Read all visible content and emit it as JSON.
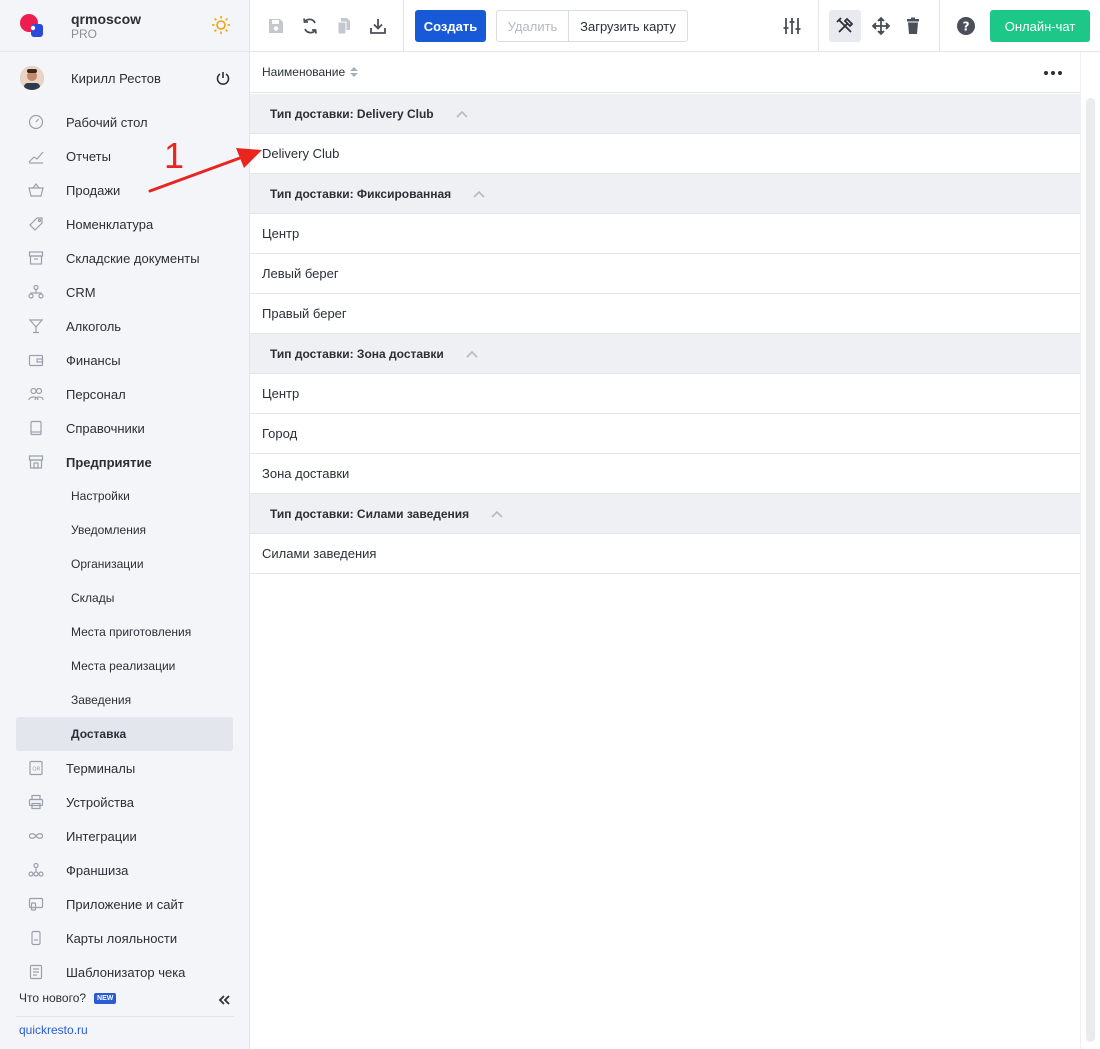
{
  "brand": {
    "name": "qrmoscow",
    "plan": "PRO"
  },
  "user": {
    "name": "Кирилл Рестов"
  },
  "menu": [
    {
      "label": "Рабочий стол",
      "icon": "dashboard-icon"
    },
    {
      "label": "Отчеты",
      "icon": "reports-icon"
    },
    {
      "label": "Продажи",
      "icon": "sales-icon"
    },
    {
      "label": "Номенклатура",
      "icon": "tag-icon"
    },
    {
      "label": "Складские документы",
      "icon": "archive-icon"
    },
    {
      "label": "CRM",
      "icon": "crm-icon"
    },
    {
      "label": "Алкоголь",
      "icon": "cocktail-icon"
    },
    {
      "label": "Финансы",
      "icon": "wallet-icon"
    },
    {
      "label": "Персонал",
      "icon": "staff-icon"
    },
    {
      "label": "Справочники",
      "icon": "book-icon"
    },
    {
      "label": "Предприятие",
      "icon": "store-icon"
    }
  ],
  "submenu": [
    "Настройки",
    "Уведомления",
    "Организации",
    "Склады",
    "Места приготовления",
    "Места реализации",
    "Заведения",
    "Доставка"
  ],
  "menu_bottom": [
    {
      "label": "Терминалы",
      "icon": "qr-terminal-icon"
    },
    {
      "label": "Устройства",
      "icon": "printer-icon"
    },
    {
      "label": "Интеграции",
      "icon": "infinity-icon"
    },
    {
      "label": "Франшиза",
      "icon": "franchise-icon"
    },
    {
      "label": "Приложение и сайт",
      "icon": "app-site-icon"
    },
    {
      "label": "Карты лояльности",
      "icon": "loyalty-card-icon"
    },
    {
      "label": "Шаблонизатор чека",
      "icon": "receipt-icon"
    }
  ],
  "footer": {
    "whats_new": "Что нового?",
    "badge": "NEW",
    "site": "quickresto.ru"
  },
  "toolbar": {
    "create": "Создать",
    "delete": "Удалить",
    "load_map": "Загрузить карту",
    "online_chat": "Онлайн-чат"
  },
  "table": {
    "column": "Наименование",
    "groups": [
      {
        "title": "Тип доставки: Delivery Club",
        "rows": [
          "Delivery Club"
        ]
      },
      {
        "title": "Тип доставки: Фиксированная",
        "rows": [
          "Центр",
          "Левый берег",
          "Правый берег"
        ]
      },
      {
        "title": "Тип доставки: Зона доставки",
        "rows": [
          "Центр",
          "Город",
          "Зона доставки"
        ]
      },
      {
        "title": "Тип доставки: Силами заведения",
        "rows": [
          "Силами заведения"
        ]
      }
    ]
  },
  "annotation": {
    "number": "1"
  },
  "colors": {
    "primary": "#1759d6",
    "chat": "#1dc788",
    "annotation": "#e8261f",
    "sidebar_bg": "#f4f5f9"
  }
}
